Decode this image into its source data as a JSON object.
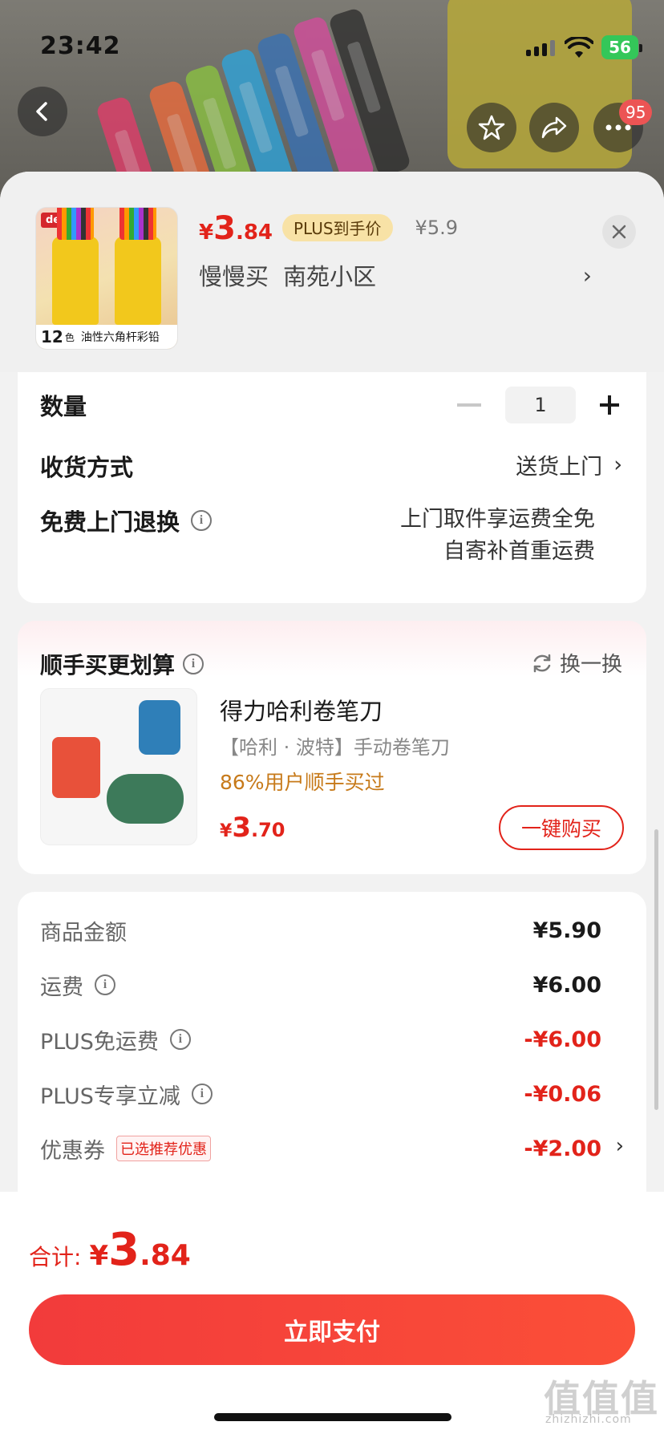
{
  "status_bar": {
    "time": "23:42",
    "battery": "56"
  },
  "top_nav": {
    "cart_badge": "95"
  },
  "product": {
    "price_yen": "¥",
    "price_int": "3",
    "price_dec": ".84",
    "plus_tag": "PLUS到手价",
    "original_price": "¥5.9",
    "address_name": "慢慢买",
    "address_detail": "南苑小区",
    "thumb_brand": "deli",
    "thumb_count": "12",
    "thumb_count_unit": "色",
    "thumb_caption": "油性六角杆彩铅"
  },
  "options": {
    "quantity_label": "数量",
    "quantity_value": "1",
    "delivery_label": "收货方式",
    "delivery_value": "送货上门",
    "return_label": "免费上门退换",
    "return_line1": "上门取件享运费全免",
    "return_line2": "自寄补首重运费"
  },
  "recommend": {
    "title": "顺手买更划算",
    "swap_label": "换一换",
    "name": "得力哈利卷笔刀",
    "subtitle": "【哈利 · 波特】手动卷笔刀",
    "stat": "86%用户顺手买过",
    "price_yen": "¥",
    "price_int": "3",
    "price_dec": ".70",
    "buy_label": "一键购买"
  },
  "fees": [
    {
      "label": "商品金额",
      "value": "¥5.90",
      "info": false,
      "red": false
    },
    {
      "label": "运费",
      "value": "¥6.00",
      "info": true,
      "red": false
    },
    {
      "label": "PLUS免运费",
      "value": "-¥6.00",
      "info": true,
      "red": true
    },
    {
      "label": "PLUS专享立减",
      "value": "-¥0.06",
      "info": true,
      "red": true
    },
    {
      "label": "优惠券",
      "value": "-¥2.00",
      "tag": "已选推荐优惠",
      "red": true
    }
  ],
  "footer": {
    "total_label": "合计:",
    "total_yen": "¥",
    "total_int": "3",
    "total_dec": ".84",
    "pay_label": "立即支付",
    "watermark": "值值值",
    "watermark_sub": "zhizhizhi.com"
  },
  "colors": {
    "accent": "#e2231a",
    "plus_tag_bg": "#f8e2a6",
    "stat_orange": "#c77a1a"
  }
}
